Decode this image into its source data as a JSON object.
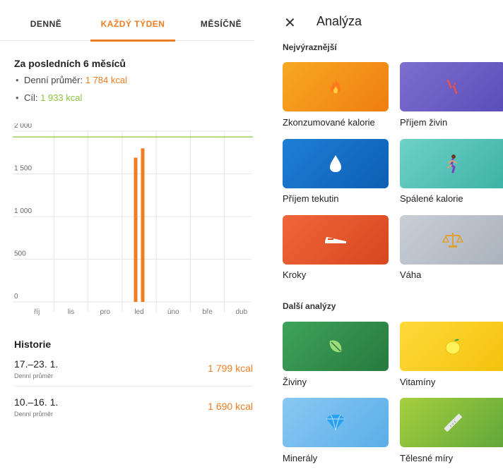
{
  "tabs": [
    {
      "label": "DENNĚ"
    },
    {
      "label": "KAŽDÝ TÝDEN"
    },
    {
      "label": "MĚSÍČNĚ"
    }
  ],
  "summary": {
    "title": "Za posledních 6 měsíců",
    "avg_label": "Denní průměr:",
    "avg_value": "1 784 kcal",
    "goal_label": "Cíl:",
    "goal_value": "1 933 kcal"
  },
  "chart_data": {
    "type": "bar",
    "categories": [
      "říj",
      "lis",
      "pro",
      "led",
      "úno",
      "bře",
      "dub"
    ],
    "y_ticks": [
      "2 000",
      "1 500",
      "1 000",
      "500",
      "0"
    ],
    "ylim": [
      0,
      2000
    ],
    "bars": [
      {
        "category": "led",
        "week": 1,
        "value": 1690
      },
      {
        "category": "led",
        "week": 2,
        "value": 1799
      }
    ],
    "goal_line": 1933,
    "colors": {
      "bar": "#ef7d22",
      "goal": "#8cc63f",
      "grid": "#e6e6e6"
    },
    "grid": true
  },
  "history": {
    "title": "Historie",
    "rows": [
      {
        "date": "17.–23. 1.",
        "sub": "Denní průměr",
        "value": "1 799 kcal"
      },
      {
        "date": "10.–16. 1.",
        "sub": "Denní průměr",
        "value": "1 690 kcal"
      }
    ]
  },
  "analysis": {
    "close_icon": "close-icon",
    "title": "Analýza",
    "section1": "Nejvýraznější",
    "section2": "Další analýzy",
    "cards": [
      {
        "label": "Zkonzumované kalorie",
        "icon": "flame-icon"
      },
      {
        "label": "Příjem živin",
        "icon": "nutrients-icon"
      },
      {
        "label": "Příjem tekutin",
        "icon": "water-drop-icon"
      },
      {
        "label": "Spálené kalorie",
        "icon": "runner-icon"
      },
      {
        "label": "Kroky",
        "icon": "shoe-icon"
      },
      {
        "label": "Váha",
        "icon": "scale-icon"
      },
      {
        "label": "Živiny",
        "icon": "leaf-icon"
      },
      {
        "label": "Vitamíny",
        "icon": "lemon-icon"
      },
      {
        "label": "Minerály",
        "icon": "diamond-icon"
      },
      {
        "label": "Tělesné míry",
        "icon": "ruler-icon"
      }
    ]
  }
}
